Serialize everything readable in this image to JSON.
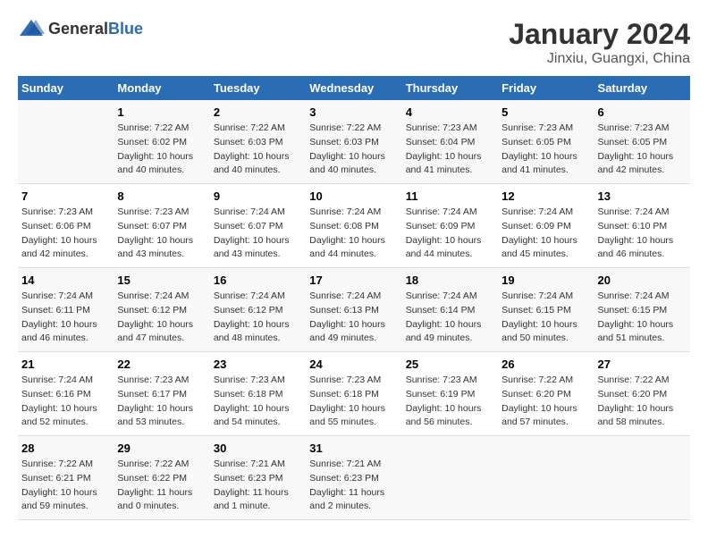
{
  "header": {
    "logo_general": "General",
    "logo_blue": "Blue",
    "title": "January 2024",
    "subtitle": "Jinxiu, Guangxi, China"
  },
  "calendar": {
    "days_of_week": [
      "Sunday",
      "Monday",
      "Tuesday",
      "Wednesday",
      "Thursday",
      "Friday",
      "Saturday"
    ],
    "weeks": [
      [
        {
          "day": "",
          "info": ""
        },
        {
          "day": "1",
          "info": "Sunrise: 7:22 AM\nSunset: 6:02 PM\nDaylight: 10 hours\nand 40 minutes."
        },
        {
          "day": "2",
          "info": "Sunrise: 7:22 AM\nSunset: 6:03 PM\nDaylight: 10 hours\nand 40 minutes."
        },
        {
          "day": "3",
          "info": "Sunrise: 7:22 AM\nSunset: 6:03 PM\nDaylight: 10 hours\nand 40 minutes."
        },
        {
          "day": "4",
          "info": "Sunrise: 7:23 AM\nSunset: 6:04 PM\nDaylight: 10 hours\nand 41 minutes."
        },
        {
          "day": "5",
          "info": "Sunrise: 7:23 AM\nSunset: 6:05 PM\nDaylight: 10 hours\nand 41 minutes."
        },
        {
          "day": "6",
          "info": "Sunrise: 7:23 AM\nSunset: 6:05 PM\nDaylight: 10 hours\nand 42 minutes."
        }
      ],
      [
        {
          "day": "7",
          "info": "Sunrise: 7:23 AM\nSunset: 6:06 PM\nDaylight: 10 hours\nand 42 minutes."
        },
        {
          "day": "8",
          "info": "Sunrise: 7:23 AM\nSunset: 6:07 PM\nDaylight: 10 hours\nand 43 minutes."
        },
        {
          "day": "9",
          "info": "Sunrise: 7:24 AM\nSunset: 6:07 PM\nDaylight: 10 hours\nand 43 minutes."
        },
        {
          "day": "10",
          "info": "Sunrise: 7:24 AM\nSunset: 6:08 PM\nDaylight: 10 hours\nand 44 minutes."
        },
        {
          "day": "11",
          "info": "Sunrise: 7:24 AM\nSunset: 6:09 PM\nDaylight: 10 hours\nand 44 minutes."
        },
        {
          "day": "12",
          "info": "Sunrise: 7:24 AM\nSunset: 6:09 PM\nDaylight: 10 hours\nand 45 minutes."
        },
        {
          "day": "13",
          "info": "Sunrise: 7:24 AM\nSunset: 6:10 PM\nDaylight: 10 hours\nand 46 minutes."
        }
      ],
      [
        {
          "day": "14",
          "info": "Sunrise: 7:24 AM\nSunset: 6:11 PM\nDaylight: 10 hours\nand 46 minutes."
        },
        {
          "day": "15",
          "info": "Sunrise: 7:24 AM\nSunset: 6:12 PM\nDaylight: 10 hours\nand 47 minutes."
        },
        {
          "day": "16",
          "info": "Sunrise: 7:24 AM\nSunset: 6:12 PM\nDaylight: 10 hours\nand 48 minutes."
        },
        {
          "day": "17",
          "info": "Sunrise: 7:24 AM\nSunset: 6:13 PM\nDaylight: 10 hours\nand 49 minutes."
        },
        {
          "day": "18",
          "info": "Sunrise: 7:24 AM\nSunset: 6:14 PM\nDaylight: 10 hours\nand 49 minutes."
        },
        {
          "day": "19",
          "info": "Sunrise: 7:24 AM\nSunset: 6:15 PM\nDaylight: 10 hours\nand 50 minutes."
        },
        {
          "day": "20",
          "info": "Sunrise: 7:24 AM\nSunset: 6:15 PM\nDaylight: 10 hours\nand 51 minutes."
        }
      ],
      [
        {
          "day": "21",
          "info": "Sunrise: 7:24 AM\nSunset: 6:16 PM\nDaylight: 10 hours\nand 52 minutes."
        },
        {
          "day": "22",
          "info": "Sunrise: 7:23 AM\nSunset: 6:17 PM\nDaylight: 10 hours\nand 53 minutes."
        },
        {
          "day": "23",
          "info": "Sunrise: 7:23 AM\nSunset: 6:18 PM\nDaylight: 10 hours\nand 54 minutes."
        },
        {
          "day": "24",
          "info": "Sunrise: 7:23 AM\nSunset: 6:18 PM\nDaylight: 10 hours\nand 55 minutes."
        },
        {
          "day": "25",
          "info": "Sunrise: 7:23 AM\nSunset: 6:19 PM\nDaylight: 10 hours\nand 56 minutes."
        },
        {
          "day": "26",
          "info": "Sunrise: 7:22 AM\nSunset: 6:20 PM\nDaylight: 10 hours\nand 57 minutes."
        },
        {
          "day": "27",
          "info": "Sunrise: 7:22 AM\nSunset: 6:20 PM\nDaylight: 10 hours\nand 58 minutes."
        }
      ],
      [
        {
          "day": "28",
          "info": "Sunrise: 7:22 AM\nSunset: 6:21 PM\nDaylight: 10 hours\nand 59 minutes."
        },
        {
          "day": "29",
          "info": "Sunrise: 7:22 AM\nSunset: 6:22 PM\nDaylight: 11 hours\nand 0 minutes."
        },
        {
          "day": "30",
          "info": "Sunrise: 7:21 AM\nSunset: 6:23 PM\nDaylight: 11 hours\nand 1 minute."
        },
        {
          "day": "31",
          "info": "Sunrise: 7:21 AM\nSunset: 6:23 PM\nDaylight: 11 hours\nand 2 minutes."
        },
        {
          "day": "",
          "info": ""
        },
        {
          "day": "",
          "info": ""
        },
        {
          "day": "",
          "info": ""
        }
      ]
    ]
  }
}
